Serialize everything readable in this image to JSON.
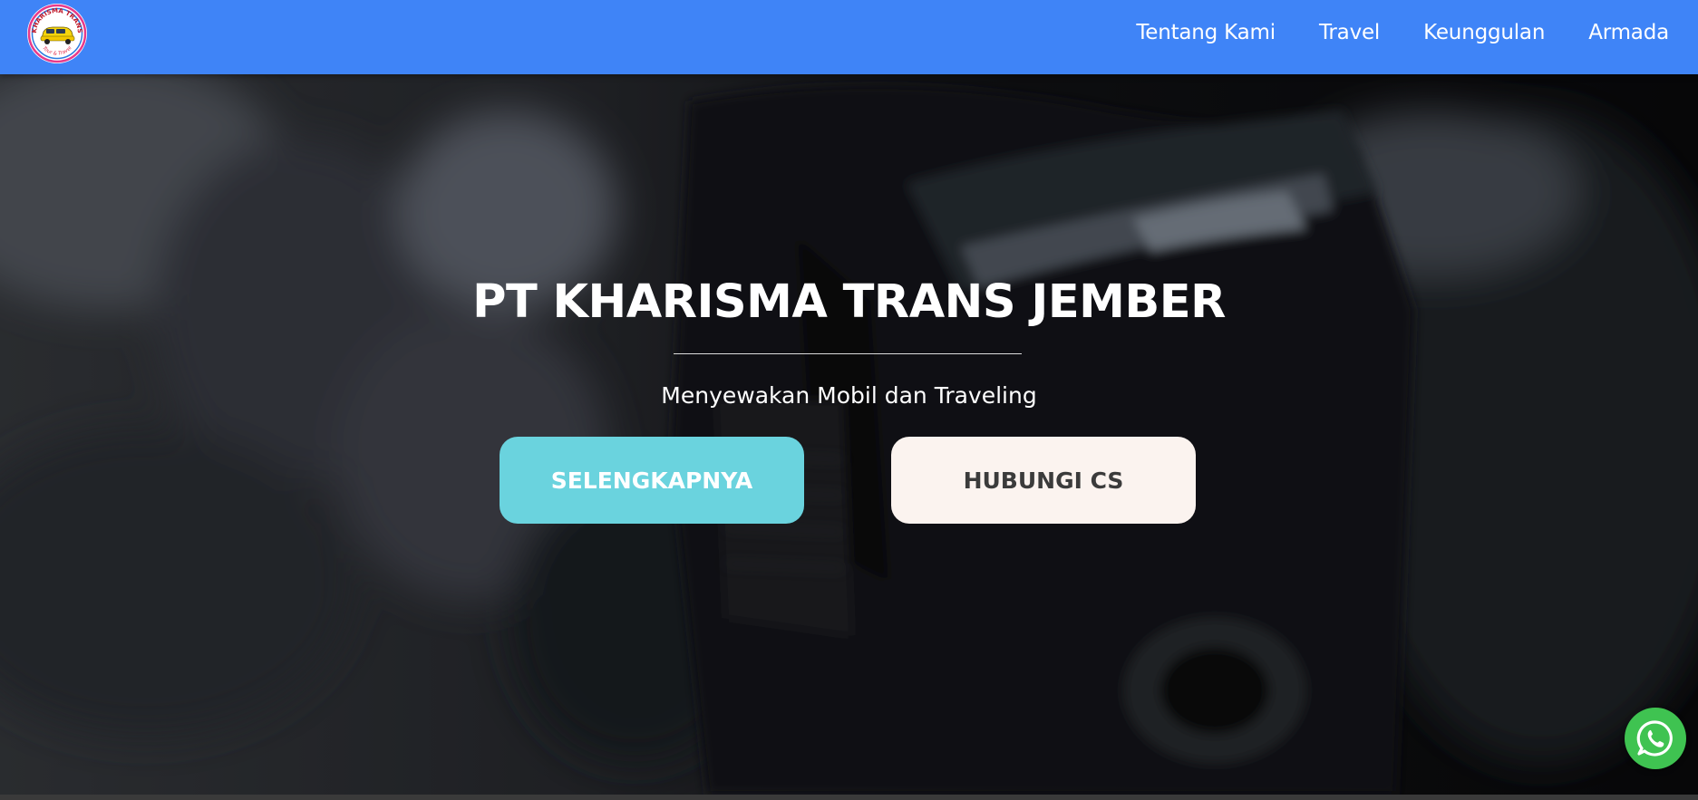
{
  "brand": {
    "logo_text_top": "KHARISMA TRANS",
    "logo_text_bottom": "Tour & Travel",
    "color": "#3f84f7"
  },
  "nav": {
    "items": [
      {
        "label": "Tentang Kami"
      },
      {
        "label": "Travel"
      },
      {
        "label": "Keunggulan"
      },
      {
        "label": "Armada"
      }
    ]
  },
  "hero": {
    "title": "PT KHARISMA TRANS JEMBER",
    "subtitle": "Menyewakan Mobil dan Traveling",
    "primary_button": "SELENGKAPNYA",
    "secondary_button": "HUBUNGI CS",
    "primary_color": "#6ad3de",
    "secondary_color": "#fbf3ef"
  },
  "floating": {
    "whatsapp_icon": "whatsapp-icon",
    "whatsapp_color": "#3fc351"
  }
}
